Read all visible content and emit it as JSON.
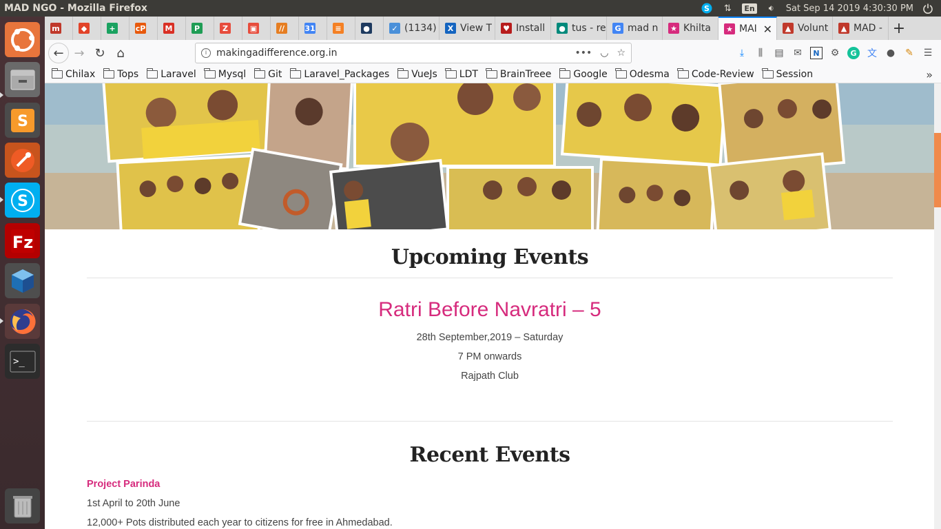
{
  "topbar": {
    "window_title": "MAD NGO - Mozilla Firefox",
    "keyboard_lang": "En",
    "datetime": "Sat Sep 14 2019  4:30:30 PM",
    "icons": [
      "skype-tray-icon",
      "network-icon",
      "keyboard-lang-icon",
      "volume-icon",
      "power-icon"
    ]
  },
  "launcher": {
    "items": [
      "ubuntu-dash-icon",
      "files-icon",
      "sublime-text-icon",
      "postman-icon",
      "skype-icon",
      "filezilla-icon",
      "virtualbox-icon",
      "firefox-icon",
      "terminal-icon",
      "trash-icon"
    ]
  },
  "tabs": [
    {
      "label": "",
      "color": "#c0392b",
      "glyph": "m"
    },
    {
      "label": "",
      "color": "#e24329",
      "glyph": "◆"
    },
    {
      "label": "",
      "color": "#1aa260",
      "glyph": "+"
    },
    {
      "label": "",
      "color": "#e8590c",
      "glyph": "cP"
    },
    {
      "label": "",
      "color": "#d93025",
      "glyph": "M"
    },
    {
      "label": "",
      "color": "#1f9d55",
      "glyph": "P"
    },
    {
      "label": "",
      "color": "#e74c3c",
      "glyph": "Z"
    },
    {
      "label": "",
      "color": "#e74c3c",
      "glyph": "▣"
    },
    {
      "label": "",
      "color": "#e67e22",
      "glyph": "//"
    },
    {
      "label": "",
      "color": "#4285f4",
      "glyph": "31"
    },
    {
      "label": "",
      "color": "#f48024",
      "glyph": "≡"
    },
    {
      "label": "",
      "color": "#1e3a5f",
      "glyph": "●"
    },
    {
      "label": "(1134)",
      "color": "#4a90d9",
      "glyph": "✓"
    },
    {
      "label": "View T",
      "color": "#1565c0",
      "glyph": "X"
    },
    {
      "label": "Install",
      "color": "#b71c1c",
      "glyph": "♥"
    },
    {
      "label": "tus - re",
      "color": "#00897b",
      "glyph": "●"
    },
    {
      "label": "mad n",
      "color": "#4285f4",
      "glyph": "G"
    },
    {
      "label": "Khilta",
      "color": "#d62b7d",
      "glyph": "★"
    },
    {
      "label": "MAI",
      "color": "#d62b7d",
      "glyph": "★",
      "active": true
    },
    {
      "label": "Volunt",
      "color": "#c0392b",
      "glyph": "▲"
    },
    {
      "label": "MAD -",
      "color": "#c0392b",
      "glyph": "▲"
    }
  ],
  "navbar": {
    "url": "makingadifference.org.in"
  },
  "bookmarks": [
    "Chilax",
    "Tops",
    "Laravel",
    "Mysql",
    "Git",
    "Laravel_Packages",
    "VueJs",
    "LDT",
    "BrainTreee",
    "Google",
    "Odesma",
    "Code-Review",
    "Session"
  ],
  "upcoming": {
    "heading": "Upcoming Events",
    "event_title": "Ratri Before Navratri – 5",
    "date": "28th September,2019 – Saturday",
    "time": "7 PM onwards",
    "venue": "Rajpath Club"
  },
  "recent": {
    "heading": "Recent Events",
    "event_title": "Project Parinda",
    "date": "1st April to 20th June",
    "desc": "12,000+ Pots distributed each year to citizens for free in Ahmedabad."
  }
}
